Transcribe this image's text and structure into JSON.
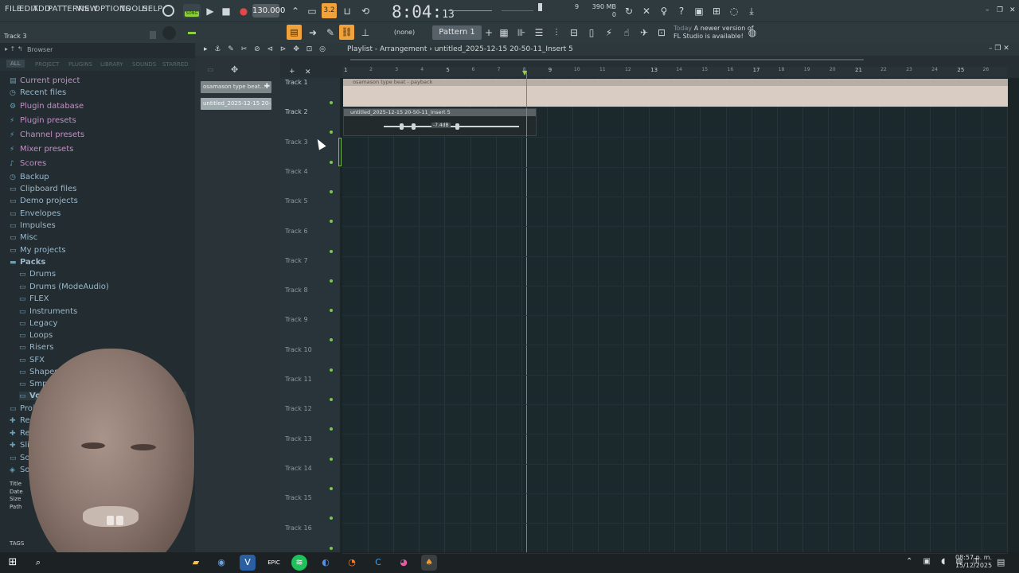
{
  "menu": [
    "FILE",
    "EDIT",
    "ADD",
    "PATTERNS",
    "VIEW",
    "OPTIONS",
    "TOOLS",
    "HELP"
  ],
  "transport": {
    "song_mode_label": "SONG",
    "tempo": "130.000",
    "clock_main": "8:04:",
    "clock_sub": "13"
  },
  "perf": {
    "cpu_value": "9",
    "memory": "390 MB",
    "voices": "0"
  },
  "hint_text": "Track 3",
  "pattern": {
    "name": "Pattern 1",
    "preset_box": "(none)"
  },
  "news": {
    "date": "Today",
    "line1": "A newer version of",
    "line2": "FL Studio is available!"
  },
  "browser": {
    "title": "Browser",
    "tabs": [
      "ALL",
      "PROJECT",
      "PLUGINS",
      "LIBRARY",
      "SOUNDS",
      "STARRED"
    ],
    "items": [
      {
        "label": "Current project",
        "color": "pink"
      },
      {
        "label": "Recent files",
        "color": "blue"
      },
      {
        "label": "Plugin database",
        "color": "pink"
      },
      {
        "label": "Plugin presets",
        "color": "pink"
      },
      {
        "label": "Channel presets",
        "color": "pink"
      },
      {
        "label": "Mixer presets",
        "color": "pink"
      },
      {
        "label": "Scores",
        "color": "pink"
      },
      {
        "label": "Backup",
        "color": "blue"
      },
      {
        "label": "Clipboard files",
        "color": "blue"
      },
      {
        "label": "Demo projects",
        "color": "blue"
      },
      {
        "label": "Envelopes",
        "color": "blue"
      },
      {
        "label": "Impulses",
        "color": "blue"
      },
      {
        "label": "Misc",
        "color": "blue"
      },
      {
        "label": "My projects",
        "color": "blue"
      },
      {
        "label": "Packs",
        "color": "blue"
      }
    ],
    "pack_items": [
      "Drums",
      "Drums (ModeAudio)",
      "FLEX",
      "Instruments",
      "Legacy",
      "Loops",
      "Risers",
      "SFX",
      "Shapes",
      "Smp",
      "Vo"
    ],
    "lower_items": [
      "Proj",
      "Reco",
      "Ren",
      "Slic",
      "Sou",
      "Sou"
    ],
    "info_labels": [
      "Title",
      "Date",
      "Size",
      "Path"
    ],
    "tags_label": "TAGS"
  },
  "picker": {
    "clips": [
      "osamason type beat...",
      "untitled_2025-12-15 20-..."
    ]
  },
  "playlist": {
    "title": "Playlist - Arrangement",
    "subtitle": "untitled_2025-12-15 20-50-11_Insert 5",
    "ruler": [
      "1",
      "2",
      "3",
      "4",
      "5",
      "6",
      "7",
      "8",
      "9",
      "10",
      "11",
      "12",
      "13",
      "14",
      "15",
      "16",
      "17",
      "18",
      "19",
      "20",
      "21",
      "22",
      "23",
      "24",
      "25",
      "26"
    ],
    "tracks": [
      "Track 1",
      "Track 2",
      "Track 3",
      "Track 4",
      "Track 5",
      "Track 6",
      "Track 7",
      "Track 8",
      "Track 9",
      "Track 10",
      "Track 11",
      "Track 12",
      "Track 13",
      "Track 14",
      "Track 15",
      "Track 16"
    ],
    "clip1_label": "osamason type beat - payback",
    "clip2_label": "untitled_2025-12-15 20-50-11_Insert 5",
    "clip2_gain": "-7.4dB"
  },
  "taskbar": {
    "time": "08:57 p. m.",
    "date": "15/12/2025"
  }
}
